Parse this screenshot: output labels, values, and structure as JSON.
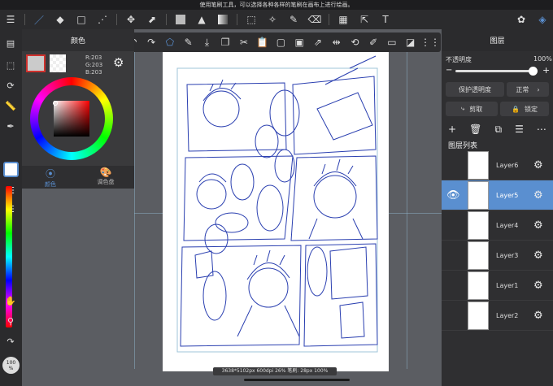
{
  "hint_bar": {
    "text": "使用笔刷工具，可以选择各种各样的笔刷在画布上进行绘画。"
  },
  "color_panel": {
    "title": "颜色",
    "r_label": "R:203",
    "g_label": "G:203",
    "b_label": "B:203",
    "tab_color": "颜色",
    "tab_palette": "调色盘",
    "current_color": "#cbcbcb"
  },
  "layers_panel": {
    "title": "图层",
    "opacity_label": "不透明度",
    "opacity_value": "100%",
    "protect_alpha": "保护透明度",
    "blend_mode": "正常",
    "clip_label": "剪取",
    "lock_label": "锁定",
    "list_title": "图层列表",
    "layers": [
      {
        "name": "Layer6",
        "selected": false,
        "visible": false
      },
      {
        "name": "Layer5",
        "selected": true,
        "visible": true
      },
      {
        "name": "Layer4",
        "selected": false,
        "visible": false
      },
      {
        "name": "Layer3",
        "selected": false,
        "visible": false
      },
      {
        "name": "Layer1",
        "selected": false,
        "visible": false
      },
      {
        "name": "Layer2",
        "selected": false,
        "visible": false
      }
    ]
  },
  "status_bar": {
    "text": "3638*5102px 600dpi 26% 笔刷: 28px 100%"
  },
  "left_toolbar": {
    "brush_size": "100",
    "brush_size_unit": "%"
  },
  "colors": {
    "accent": "#5a8fd0",
    "sketch": "#2a3fb0"
  }
}
